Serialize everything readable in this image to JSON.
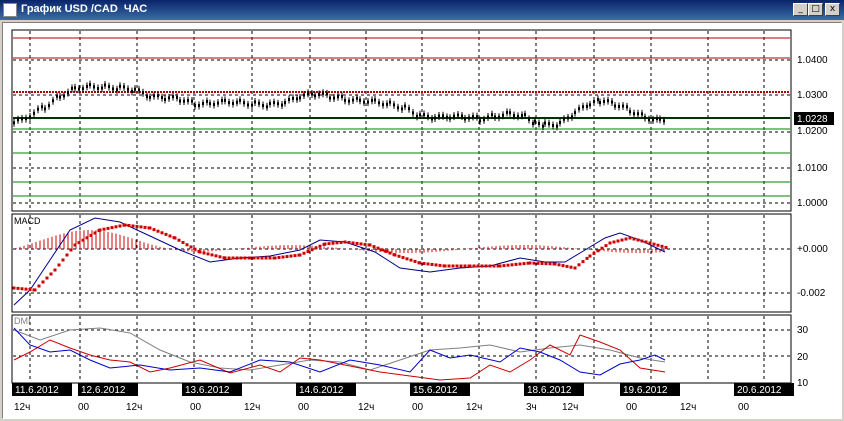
{
  "window": {
    "title": "График USD /CAD  ЧАС",
    "min_label": "_",
    "max_label": "□",
    "close_label": "x"
  },
  "price_panel": {
    "ticks": [
      "1.0400",
      "1.0300",
      "1.0200",
      "1.0100",
      "1.0000"
    ],
    "current_price": "1.0228"
  },
  "macd_panel": {
    "label": "MACD",
    "ticks": [
      "+0.000",
      "-0.002"
    ]
  },
  "dmi_panel": {
    "label": "DMI",
    "ticks": [
      "30",
      "20",
      "10"
    ]
  },
  "date_labels": [
    "11.6.2012",
    "12.6.2012",
    "13.6.2012",
    "14.6.2012",
    "15.6.2012",
    "18.6.2012",
    "19.6.2012",
    "20.6.2012"
  ],
  "hour_labels": [
    "12ч",
    "00",
    "12ч",
    "00",
    "12ч",
    "00",
    "12ч",
    "00",
    "12ч",
    "3ч",
    "12ч",
    "00",
    "12ч",
    "00"
  ],
  "colors": {
    "titlebar": "#0a246a",
    "resistance": "#b00000",
    "support": "#008000",
    "macd_line": "#00008b",
    "macd_signal": "#cc0000",
    "dmi_plus": "#cc0000",
    "dmi_minus": "#0000cc",
    "adx": "#808080"
  }
}
